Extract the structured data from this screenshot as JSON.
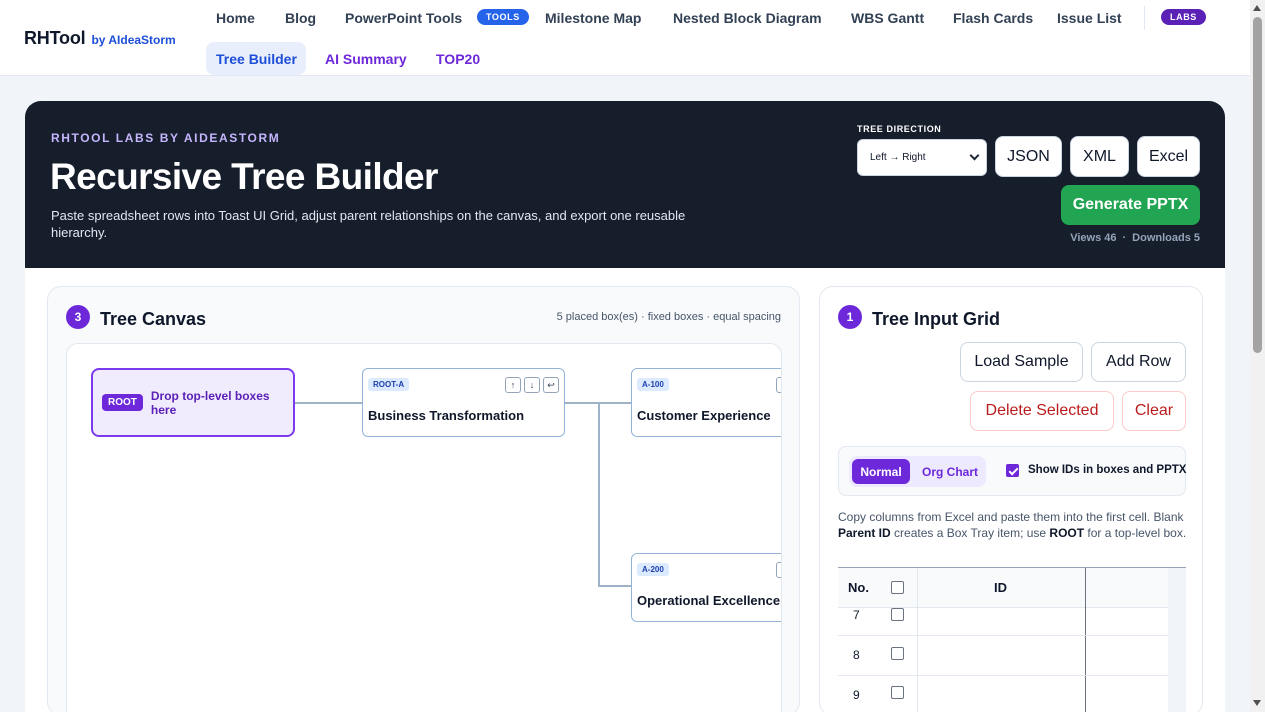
{
  "brand": {
    "name": "RHTool",
    "by": "by",
    "company": "AIdeaStorm"
  },
  "nav": {
    "row1": [
      "Home",
      "Blog",
      "PowerPoint Tools",
      "Milestone Map",
      "Nested Block Diagram",
      "WBS Gantt",
      "Flash Cards",
      "Issue List"
    ],
    "tools_badge": "TOOLS",
    "labs_badge": "LABS",
    "row2": [
      "Tree Builder",
      "AI Summary",
      "TOP20"
    ]
  },
  "hero": {
    "eyebrow": "RHTOOL LABS BY AIDEASTORM",
    "title": "Recursive Tree Builder",
    "description": "Paste spreadsheet rows into Toast UI Grid, adjust parent relationships on the canvas, and export one reusable hierarchy.",
    "direction_label": "TREE DIRECTION",
    "direction_value": "Left → Right",
    "json_button": "JSON",
    "xml_button": "XML",
    "excel_button": "Excel",
    "generate_button": "Generate PPTX",
    "views": "Views 46",
    "stats_sep": "·",
    "downloads": "Downloads 5"
  },
  "canvas": {
    "step": "3",
    "title": "Tree Canvas",
    "meta": "5 placed box(es) · fixed boxes · equal spacing",
    "root_tag": "ROOT",
    "root_text": "Drop top-level boxes here",
    "nodes": [
      {
        "id": "ROOT-A",
        "label": "Business Transformation"
      },
      {
        "id": "A-100",
        "label": "Customer Experience"
      },
      {
        "id": "A-200",
        "label": "Operational Excellence"
      }
    ],
    "controls": {
      "up": "↑",
      "down": "↓",
      "back": "↩"
    }
  },
  "grid": {
    "step": "1",
    "title": "Tree Input Grid",
    "load_sample": "Load Sample",
    "add_row": "Add Row",
    "delete_selected": "Delete Selected",
    "clear": "Clear",
    "mode_normal": "Normal",
    "mode_org": "Org Chart",
    "show_ids_label": "Show IDs in boxes and PPTX",
    "help_1": "Copy columns from Excel and paste them into the first cell. Blank ",
    "help_bold_1": "Parent ID",
    "help_2": " creates a Box Tray item; use ",
    "help_bold_2": "ROOT",
    "help_3": " for a top-level box.",
    "col_no": "No.",
    "col_id": "ID",
    "rows": [
      "7",
      "8",
      "9"
    ]
  }
}
